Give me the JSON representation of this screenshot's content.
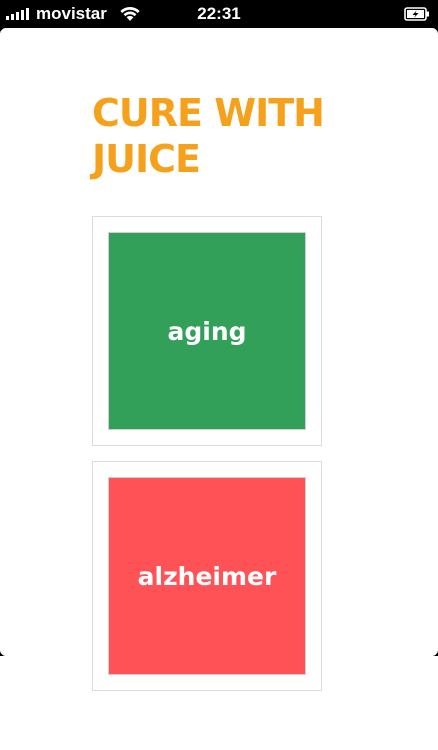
{
  "status_bar": {
    "carrier": "movistar",
    "time": "22:31",
    "signal_bars": 5,
    "icons": [
      "signal-icon",
      "wifi-icon",
      "battery-charging-icon"
    ]
  },
  "page": {
    "title": "CURE WITH JUICE"
  },
  "categories": [
    {
      "label": "aging",
      "color": "#33a05a"
    },
    {
      "label": "alzheimer",
      "color": "#ff5256"
    }
  ],
  "colors": {
    "title": "#f5a11c",
    "background": "#ffffff",
    "status_bar": "#000000"
  }
}
